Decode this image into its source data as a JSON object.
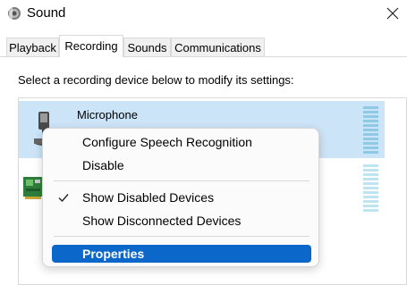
{
  "window": {
    "title": "Sound",
    "icon": "speaker-icon",
    "close_icon": "close-icon"
  },
  "tabs": [
    {
      "label": "Playback",
      "active": false
    },
    {
      "label": "Recording",
      "active": true
    },
    {
      "label": "Sounds",
      "active": false
    },
    {
      "label": "Communications",
      "active": false
    }
  ],
  "recording": {
    "instruction": "Select a recording device below to modify its settings:",
    "devices": [
      {
        "name": "Microphone",
        "icon": "microphone-icon",
        "selected": true
      },
      {
        "name": "",
        "icon": "sound-card-icon",
        "selected": false
      }
    ]
  },
  "context_menu": {
    "items": [
      {
        "label": "Configure Speech Recognition",
        "checked": false,
        "highlighted": false
      },
      {
        "label": "Disable",
        "checked": false,
        "highlighted": false
      },
      {
        "label": "Show Disabled Devices",
        "checked": true,
        "highlighted": false
      },
      {
        "label": "Show Disconnected Devices",
        "checked": false,
        "highlighted": false
      },
      {
        "label": "Properties",
        "checked": false,
        "highlighted": true
      }
    ]
  },
  "colors": {
    "selection": "#cce4f7",
    "menu_highlight": "#0b67c9",
    "level_meter": "#9fd2e8"
  }
}
